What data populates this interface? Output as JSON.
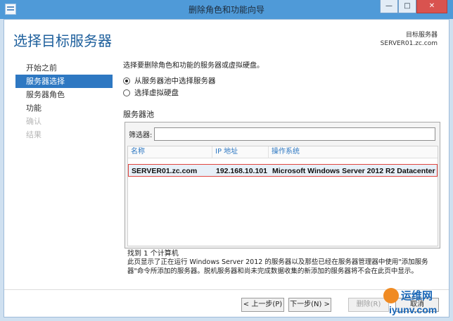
{
  "window": {
    "title": "删除角色和功能向导",
    "minimize": "—",
    "maximize": "□",
    "close": "✕"
  },
  "page_title": "选择目标服务器",
  "destination": {
    "label": "目标服务器",
    "server": "SERVER01.zc.com"
  },
  "nav": [
    {
      "label": "开始之前",
      "state": "normal"
    },
    {
      "label": "服务器选择",
      "state": "active"
    },
    {
      "label": "服务器角色",
      "state": "normal"
    },
    {
      "label": "功能",
      "state": "normal"
    },
    {
      "label": "确认",
      "state": "disabled"
    },
    {
      "label": "结果",
      "state": "disabled"
    }
  ],
  "content": {
    "description": "选择要删除角色和功能的服务器或虚拟硬盘。",
    "options": [
      {
        "label": "从服务器池中选择服务器",
        "checked": true
      },
      {
        "label": "选择虚拟硬盘",
        "checked": false
      }
    ],
    "pool_label": "服务器池",
    "filter_label": "筛选器:",
    "filter_value": "",
    "columns": [
      "名称",
      "IP 地址",
      "操作系统"
    ],
    "rows": [
      {
        "name": "SERVER01.zc.com",
        "ip": "192.168.10.101",
        "os": "Microsoft Windows Server 2012 R2 Datacenter"
      }
    ],
    "found": "找到 1 个计算机",
    "note": "此页显示了正在运行 Windows Server 2012 的服务器以及那些已经在服务器管理器中使用\"添加服务器\"命令所添加的服务器。脱机服务器和尚未完成数据收集的新添加的服务器将不会在此页中显示。"
  },
  "buttons": {
    "prev": "< 上一步(P)",
    "next": "下一步(N) >",
    "remove": "删除(R)",
    "cancel": "取消"
  },
  "watermark": {
    "top": "运维网",
    "bottom": "iyunv.com"
  },
  "colors": {
    "accent": "#2e78c2",
    "title_blue": "#1d5f9c",
    "highlight_border": "#e0453f"
  }
}
